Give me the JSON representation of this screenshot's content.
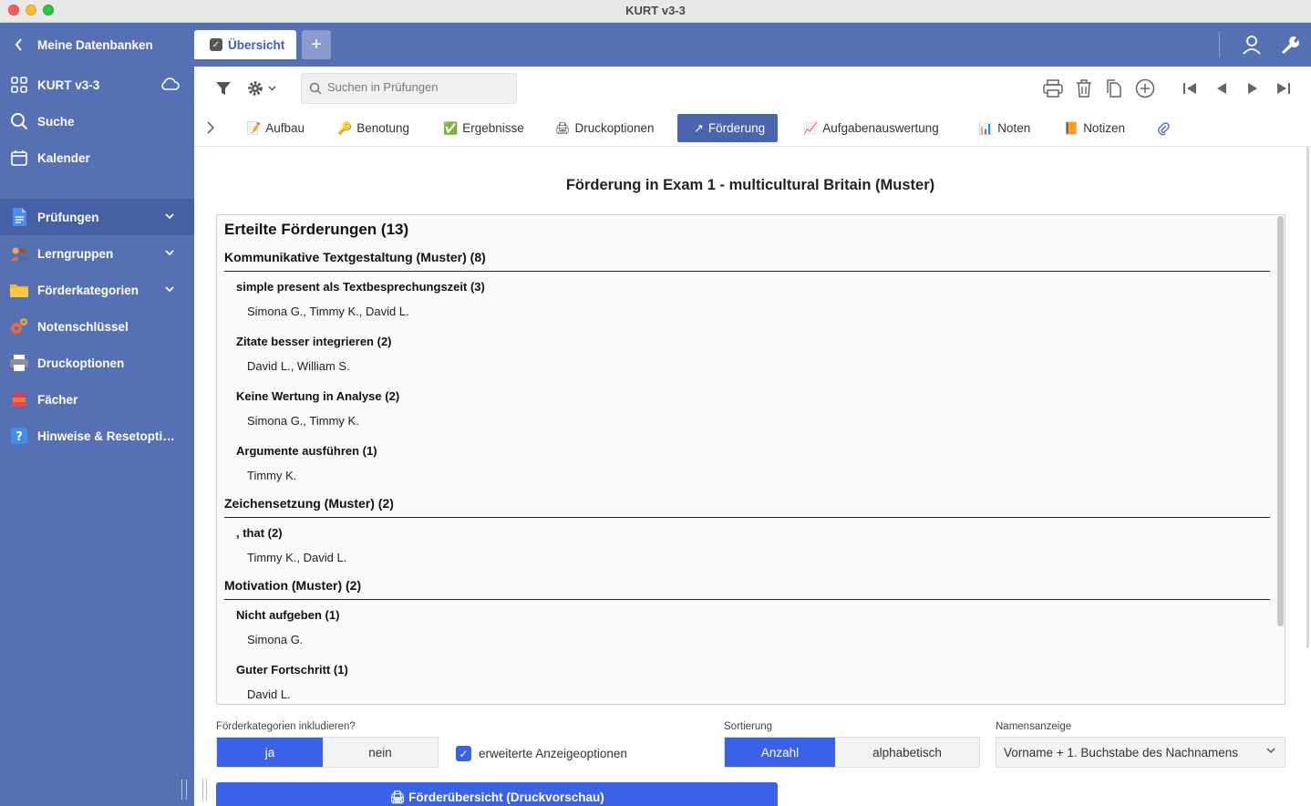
{
  "window": {
    "title": "KURT v3-3"
  },
  "sidebar": {
    "back_label": "Meine Datenbanken",
    "db_label": "KURT v3-3",
    "search_label": "Suche",
    "calendar_label": "Kalender",
    "items": [
      {
        "label": "Prüfungen",
        "icon": "document-icon",
        "expandable": true,
        "active": true
      },
      {
        "label": "Lerngruppen",
        "icon": "people-icon",
        "expandable": true
      },
      {
        "label": "Förderkategorien",
        "icon": "folder-icon",
        "expandable": true
      },
      {
        "label": "Notenschlüssel",
        "icon": "gears-icon",
        "expandable": false
      },
      {
        "label": "Druckoptionen",
        "icon": "printer-icon",
        "expandable": false
      },
      {
        "label": "Fächer",
        "icon": "books-icon",
        "expandable": false
      },
      {
        "label": "Hinweise & Resetoptio...",
        "icon": "help-icon",
        "expandable": false
      }
    ]
  },
  "topbar": {
    "tab_label": "Übersicht",
    "add_tab": "+"
  },
  "toolbar": {
    "search_placeholder": "Suchen in Prüfungen"
  },
  "subtabs": [
    {
      "label": "Aufbau",
      "icon": "📝"
    },
    {
      "label": "Benotung",
      "icon": "🔑"
    },
    {
      "label": "Ergebnisse",
      "icon": "✅"
    },
    {
      "label": "Druckoptionen",
      "icon": "🖨"
    },
    {
      "label": "Förderung",
      "icon": "↗",
      "active": true
    },
    {
      "label": "Aufgabenauswertung",
      "icon": "📈"
    },
    {
      "label": "Noten",
      "icon": "📊"
    },
    {
      "label": "Notizen",
      "icon": "📙"
    }
  ],
  "main": {
    "title": "Förderung in Exam 1 - multicultural Britain (Muster)",
    "report_heading": "Erteilte Förderungen (13)",
    "categories": [
      {
        "title": "Kommunikative Textgestaltung (Muster) (8)",
        "subs": [
          {
            "title": "simple present als Textbesprechungszeit (3)",
            "names": "Simona G., Timmy K., David L."
          },
          {
            "title": "Zitate besser integrieren (2)",
            "names": "David L., William S."
          },
          {
            "title": "Keine Wertung in Analyse (2)",
            "names": "Simona G., Timmy K."
          },
          {
            "title": "Argumente ausführen (1)",
            "names": "Timmy K."
          }
        ]
      },
      {
        "title": "Zeichensetzung (Muster) (2)",
        "subs": [
          {
            "title": ", that (2)",
            "names": "Timmy K., David L."
          }
        ]
      },
      {
        "title": "Motivation (Muster) (2)",
        "subs": [
          {
            "title": "Nicht aufgeben (1)",
            "names": "Simona G."
          },
          {
            "title": "Guter Fortschritt (1)",
            "names": "David L."
          }
        ]
      }
    ]
  },
  "controls": {
    "include_label": "Förderkategorien inkludieren?",
    "include_yes": "ja",
    "include_no": "nein",
    "extended_label": "erweiterte Anzeigeoptionen",
    "extended_checked": true,
    "sort_label": "Sortierung",
    "sort_count": "Anzahl",
    "sort_alpha": "alphabetisch",
    "names_label": "Namensanzeige",
    "names_value": "Vorname + 1. Buchstabe des Nachnamens",
    "print_button": "🖨 Förderübersicht (Druckvorschau)"
  },
  "colors": {
    "sidebar": "#5670b4",
    "accent": "#3b62e6",
    "active_tab": "#4a65b0"
  }
}
